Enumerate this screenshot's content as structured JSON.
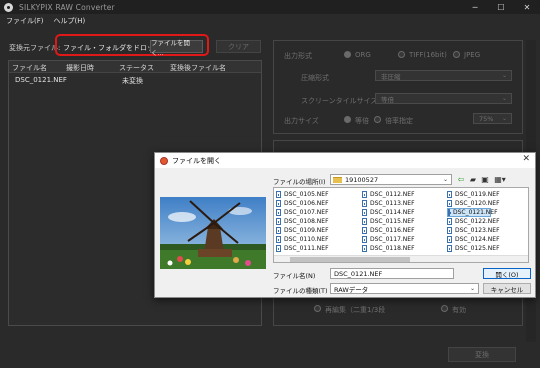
{
  "window": {
    "title": "SILKYPIX RAW Converter",
    "controls": [
      "─",
      "☐",
      "✕"
    ]
  },
  "menu": {
    "items": [
      "ファイル(F)",
      "ヘルプ(H)"
    ]
  },
  "left": {
    "source_label": "変換元ファイル:",
    "drop_hint": "ファイル・フォルダをドロップ または",
    "open_button": "ファイルを開く...",
    "clear_button": "クリア",
    "table": {
      "headers": [
        "ファイル名",
        "撮影日時",
        "ステータス",
        "変換後ファイル名"
      ],
      "rows": [
        {
          "name": "DSC_0121.NEF",
          "date": "",
          "status": "未変換",
          "converted": ""
        }
      ]
    }
  },
  "right": {
    "output_format_label": "出力形式",
    "format_options": [
      "ORG",
      "TIFF(16bit)",
      "JPEG"
    ],
    "compression_label": "圧縮形式",
    "compression_value": "非圧縮",
    "screen_tile_label": "スクリーンタイルサイズ",
    "screen_tile_value": "等倍",
    "output_size_label": "出力サイズ",
    "size_options": [
      "等倍",
      "倍率指定"
    ],
    "scale_value": "75%",
    "bottom_options": [
      "再編集（二重1/3段",
      "有効"
    ],
    "convert_button": "変換"
  },
  "dialog": {
    "title": "ファイルを開く",
    "location_label": "ファイルの場所(I)",
    "folder": "19100527",
    "toolbar_icons": [
      "back-arrow-icon",
      "up-folder-icon",
      "new-folder-icon",
      "view-menu-icon"
    ],
    "files": [
      [
        "DSC_0105.NEF",
        "DSC_0106.NEF",
        "DSC_0107.NEF",
        "DSC_0108.NEF",
        "DSC_0109.NEF",
        "DSC_0110.NEF",
        "DSC_0111.NEF"
      ],
      [
        "DSC_0112.NEF",
        "DSC_0113.NEF",
        "DSC_0114.NEF",
        "DSC_0115.NEF",
        "DSC_0116.NEF",
        "DSC_0117.NEF",
        "DSC_0118.NEF"
      ],
      [
        "DSC_0119.NEF",
        "DSC_0120.NEF",
        "DSC_0121.NEF",
        "DSC_0122.NEF",
        "DSC_0123.NEF",
        "DSC_0124.NEF",
        "DSC_0125.NEF"
      ]
    ],
    "selected_file": "DSC_0121.NEF",
    "filename_label": "ファイル名(N)",
    "filename_value": "DSC_0121.NEF",
    "filetype_label": "ファイルの種類(T)",
    "filetype_value": "RAWデータ",
    "open_button": "開く(O)",
    "cancel_button": "キャンセル"
  }
}
